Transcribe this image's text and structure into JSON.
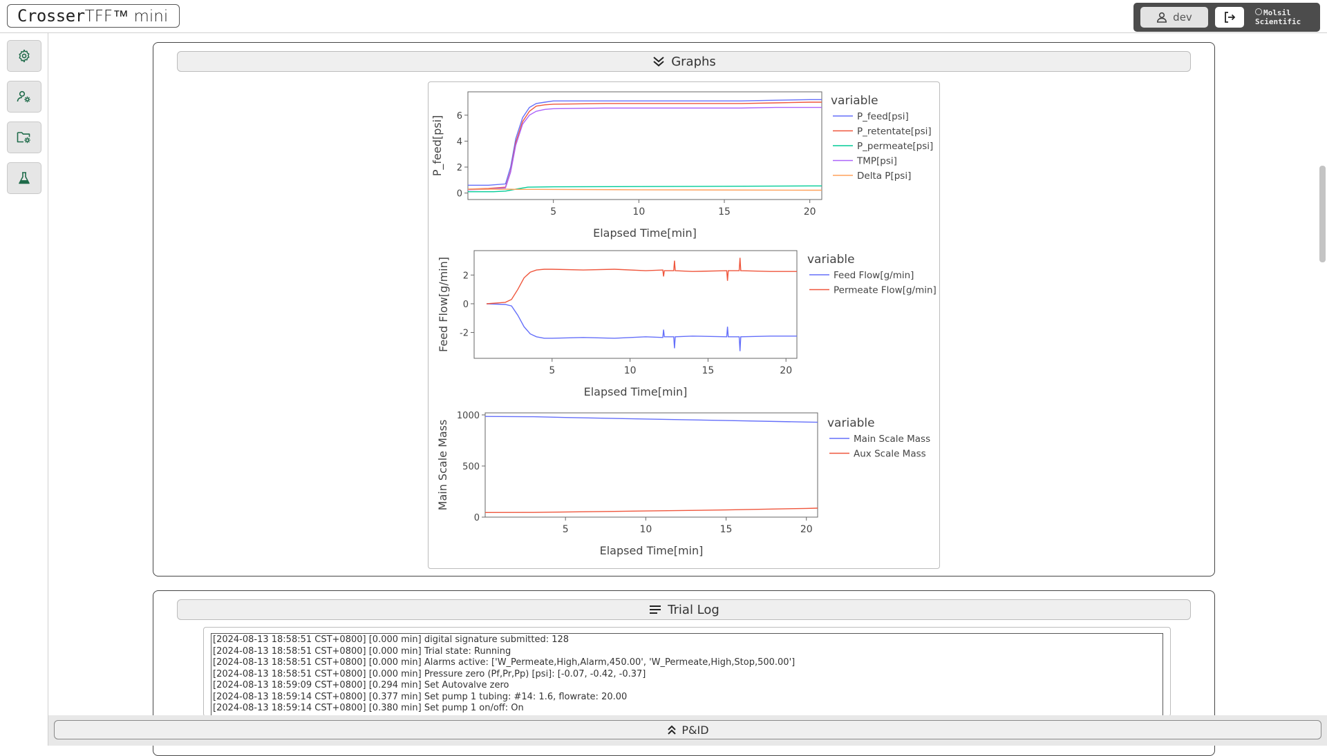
{
  "header": {
    "logo_bold": "Crosser",
    "logo_thin": "TFF™ mini",
    "user_label": "dev",
    "brand_line1": "Molsil",
    "brand_line2": "Scientific"
  },
  "sidebar": {
    "items": [
      {
        "icon": "gear-icon"
      },
      {
        "icon": "user-settings-icon"
      },
      {
        "icon": "folder-settings-icon"
      },
      {
        "icon": "flask-icon"
      }
    ]
  },
  "graphs_panel": {
    "title": "Graphs"
  },
  "log_panel": {
    "title": "Trial Log",
    "text": "[2024-08-13 18:58:51 CST+0800] [0.000 min] digital signature submitted: 128\n[2024-08-13 18:58:51 CST+0800] [0.000 min] Trial state: Running\n[2024-08-13 18:58:51 CST+0800] [0.000 min] Alarms active: ['W_Permeate,High,Alarm,450.00', 'W_Permeate,High,Stop,500.00']\n[2024-08-13 18:58:51 CST+0800] [0.000 min] Pressure zero (Pf,Pr,Pp) [psi]: [-0.07, -0.42, -0.37]\n[2024-08-13 18:59:09 CST+0800] [0.294 min] Set Autovalve zero\n[2024-08-13 18:59:14 CST+0800] [0.377 min] Set pump 1 tubing: #14: 1.6, flowrate: 20.00\n[2024-08-13 18:59:14 CST+0800] [0.380 min] Set pump 1 on/off: On"
  },
  "pid_bar": {
    "label": "P&ID"
  },
  "colors": {
    "blue": "#636efa",
    "red": "#ef553b",
    "green": "#00cc96",
    "purple": "#ab63fa",
    "orange": "#ffa15a"
  },
  "chart_data": [
    {
      "type": "line",
      "xlabel": "Elapsed Time[min]",
      "ylabel": "P_feed[psi]",
      "legend_title": "variable",
      "xlim": [
        0,
        20.7
      ],
      "ylim": [
        -0.5,
        7.8
      ],
      "xticks": [
        5,
        10,
        15,
        20
      ],
      "yticks": [
        0,
        2,
        4,
        6
      ],
      "series": [
        {
          "name": "P_feed[psi]",
          "color": "#636efa",
          "x": [
            0,
            1.2,
            2.2,
            2.5,
            2.8,
            3.2,
            3.6,
            4.0,
            4.5,
            5,
            8,
            12,
            16,
            18,
            20,
            20.7
          ],
          "y": [
            0.6,
            0.6,
            0.7,
            2.0,
            4.2,
            5.8,
            6.6,
            6.9,
            7.0,
            7.1,
            7.1,
            7.1,
            7.1,
            7.15,
            7.2,
            7.2
          ]
        },
        {
          "name": "P_retentate[psi]",
          "color": "#ef553b",
          "x": [
            0,
            1.2,
            2.2,
            2.5,
            2.8,
            3.2,
            3.6,
            4.0,
            4.5,
            5,
            8,
            12,
            16,
            18,
            20,
            20.7
          ],
          "y": [
            0.3,
            0.35,
            0.45,
            1.7,
            3.9,
            5.5,
            6.3,
            6.7,
            6.8,
            6.85,
            6.9,
            6.9,
            6.9,
            6.95,
            7.0,
            7.0
          ]
        },
        {
          "name": "P_permeate[psi]",
          "color": "#00cc96",
          "x": [
            0,
            1.5,
            2.2,
            2.8,
            3.5,
            5,
            10,
            15,
            20,
            20.7
          ],
          "y": [
            0.1,
            0.1,
            0.15,
            0.3,
            0.45,
            0.48,
            0.5,
            0.52,
            0.55,
            0.55
          ]
        },
        {
          "name": "TMP[psi]",
          "color": "#ab63fa",
          "x": [
            0,
            1.2,
            2.2,
            2.5,
            2.8,
            3.2,
            3.6,
            4.0,
            4.5,
            5,
            8,
            12,
            16,
            18,
            20,
            20.7
          ],
          "y": [
            0.25,
            0.3,
            0.4,
            1.6,
            3.7,
            5.3,
            6.0,
            6.3,
            6.45,
            6.5,
            6.55,
            6.55,
            6.55,
            6.6,
            6.6,
            6.6
          ]
        },
        {
          "name": "Delta P[psi]",
          "color": "#ffa15a",
          "x": [
            0,
            2.2,
            3,
            4,
            10,
            20,
            20.7
          ],
          "y": [
            0.3,
            0.3,
            0.28,
            0.28,
            0.25,
            0.22,
            0.22
          ]
        }
      ]
    },
    {
      "type": "line",
      "xlabel": "Elapsed Time[min]",
      "ylabel": "Feed Flow[g/min]",
      "legend_title": "variable",
      "xlim": [
        0,
        20.7
      ],
      "ylim": [
        -3.8,
        3.7
      ],
      "xticks": [
        5,
        10,
        15,
        20
      ],
      "yticks": [
        -2,
        0,
        2
      ],
      "series": [
        {
          "name": "Feed Flow[g/min]",
          "color": "#636efa",
          "x": [
            0.8,
            2.0,
            2.4,
            2.8,
            3.2,
            3.6,
            4.0,
            4.5,
            5,
            7,
            9,
            11,
            12.1,
            12.15,
            12.2,
            12.8,
            12.85,
            12.9,
            14,
            16.2,
            16.25,
            16.3,
            17.0,
            17.05,
            17.1,
            19,
            20.7
          ],
          "y": [
            0,
            -0.05,
            -0.15,
            -0.8,
            -1.6,
            -2.1,
            -2.3,
            -2.4,
            -2.4,
            -2.35,
            -2.4,
            -2.3,
            -2.35,
            -1.8,
            -2.3,
            -2.3,
            -3.1,
            -2.3,
            -2.25,
            -2.3,
            -1.6,
            -2.3,
            -2.3,
            -3.3,
            -2.3,
            -2.25,
            -2.25
          ]
        },
        {
          "name": "Permeate Flow[g/min]",
          "color": "#ef553b",
          "x": [
            0.8,
            2.0,
            2.4,
            2.8,
            3.2,
            3.6,
            4.0,
            4.5,
            5,
            7,
            9,
            11,
            12.1,
            12.15,
            12.2,
            12.8,
            12.85,
            12.9,
            14,
            16.2,
            16.25,
            16.3,
            17.0,
            17.05,
            17.1,
            19,
            20.7
          ],
          "y": [
            0,
            0.1,
            0.3,
            1.0,
            1.8,
            2.2,
            2.35,
            2.4,
            2.4,
            2.35,
            2.4,
            2.3,
            2.35,
            1.9,
            2.3,
            2.3,
            3.0,
            2.3,
            2.25,
            2.3,
            1.6,
            2.3,
            2.3,
            3.2,
            2.3,
            2.25,
            2.25
          ]
        }
      ]
    },
    {
      "type": "line",
      "xlabel": "Elapsed Time[min]",
      "ylabel": "Main Scale Mass",
      "legend_title": "variable",
      "xlim": [
        0,
        20.7
      ],
      "ylim": [
        0,
        1020
      ],
      "xticks": [
        5,
        10,
        15,
        20
      ],
      "yticks": [
        0,
        500,
        1000
      ],
      "series": [
        {
          "name": "Main Scale Mass",
          "color": "#636efa",
          "x": [
            0,
            3,
            5,
            10,
            15,
            20,
            20.7
          ],
          "y": [
            985,
            982,
            975,
            960,
            945,
            930,
            928
          ]
        },
        {
          "name": "Aux Scale Mass",
          "color": "#ef553b",
          "x": [
            0,
            3,
            5,
            10,
            15,
            20,
            20.7
          ],
          "y": [
            45,
            46,
            50,
            60,
            70,
            85,
            88
          ]
        }
      ]
    }
  ]
}
